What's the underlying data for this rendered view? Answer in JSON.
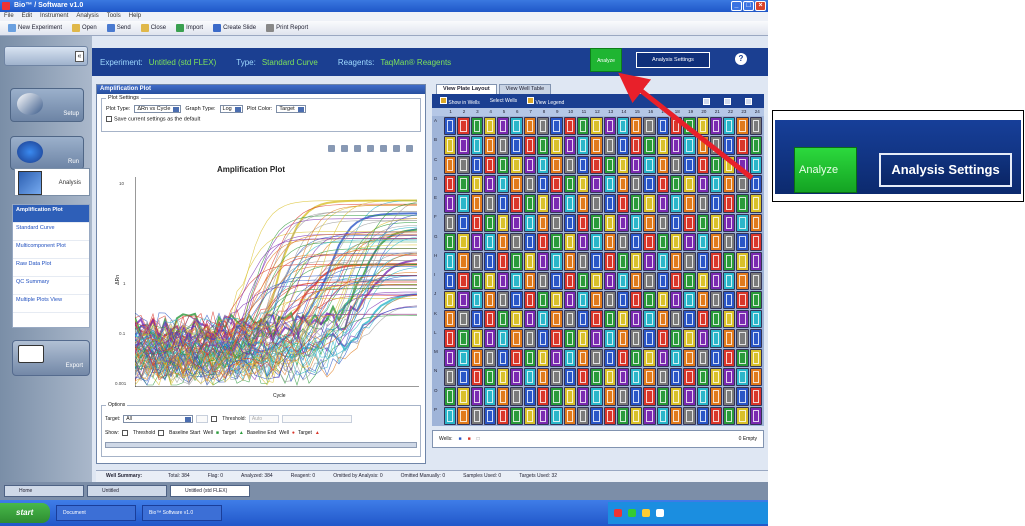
{
  "window": {
    "title": "Bio™ / Software v1.0"
  },
  "menu": [
    "File",
    "Edit",
    "Instrument",
    "Analysis",
    "Tools",
    "Help"
  ],
  "toolbar": {
    "new_experiment": "New Experiment",
    "open": "Open",
    "send": "Send",
    "close": "Close",
    "import": "Import",
    "create_slide": "Create Slide",
    "print_report": "Print Report"
  },
  "sidebar": {
    "setup": "Setup",
    "run": "Run",
    "analysis": "Analysis",
    "export": "Export",
    "nav": [
      "Amplification Plot",
      "Standard Curve",
      "Multicomponent Plot",
      "Raw Data Plot",
      "QC Summary",
      "Multiple Plots View"
    ]
  },
  "header": {
    "experiment_label": "Experiment:",
    "experiment_value": "Untitled (std FLEX)",
    "type_label": "Type:",
    "type_value": "Standard Curve",
    "reagents_label": "Reagents:",
    "reagents_value": "TaqMan® Reagents",
    "analyze": "Analyze",
    "analysis_settings": "Analysis Settings",
    "help": "?"
  },
  "amp": {
    "panel_title": "Amplification Plot",
    "plot_settings_legend": "Plot Settings",
    "plot_type_label": "Plot Type:",
    "plot_type_value": "ΔRn vs Cycle",
    "graph_type_label": "Graph Type:",
    "graph_type_value": "Log",
    "plot_color_label": "Plot Color:",
    "plot_color_value": "Target",
    "save_default": "Save current settings as the default",
    "chart_title": "Amplification Plot",
    "ylabel": "ΔRn",
    "xlabel": "Cycle",
    "yticks": [
      "10",
      "1",
      "0.1",
      "0.001"
    ],
    "options_legend": "Options",
    "target_label": "Target:",
    "target_value": "All",
    "threshold_label": "Threshold:",
    "auto_label": "Auto",
    "show_label": "Show:",
    "show_threshold": "Threshold",
    "show_baseline": "Baseline Start",
    "show_well": "Well",
    "show_target": "Target",
    "show_baseline_end": "Baseline End",
    "show_well2": "Well",
    "show_target2": "Target"
  },
  "plate": {
    "tabs": [
      "View Plate Layout",
      "View Well Table"
    ],
    "toolbar": [
      "Show in Wells",
      "Select Wells",
      "View Legend"
    ],
    "columns": [
      "1",
      "2",
      "3",
      "4",
      "5",
      "6",
      "7",
      "8",
      "9",
      "10",
      "11",
      "12",
      "13",
      "14",
      "15",
      "16",
      "17",
      "18",
      "19",
      "20",
      "21",
      "22",
      "23",
      "24"
    ],
    "rows": [
      "A",
      "B",
      "C",
      "D",
      "E",
      "F",
      "G",
      "H",
      "I",
      "J",
      "K",
      "L",
      "M",
      "N",
      "O",
      "P"
    ],
    "well_colors": [
      "#2a56c6",
      "#d9362a",
      "#2a9a3a",
      "#d9c02a",
      "#7a2ab0",
      "#2ab5c9",
      "#e07a1c",
      "#7a7a7a"
    ],
    "footer_wells": "Wells:",
    "footer_right": "0 Empty"
  },
  "summary": {
    "title": "Well Summary:",
    "items": [
      "Total: 384",
      "Flag: 0",
      "Analyzed: 384",
      "Reagent: 0",
      "Omitted by Analysis: 0",
      "Omitted Manually: 0",
      "Samples Used: 0",
      "Targets Used: 32"
    ]
  },
  "bottom_tabs": [
    "Home",
    "Untitled",
    "Untitled (std FLEX)"
  ],
  "taskbar": {
    "start": "start",
    "tasks": [
      "Document",
      "Bio™ Software v1.0"
    ]
  },
  "zoom": {
    "analyze": "Analyze",
    "analysis_settings": "Analysis Settings"
  }
}
